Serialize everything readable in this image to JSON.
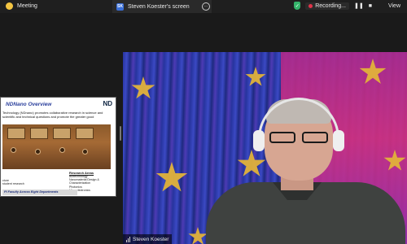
{
  "topbar": {
    "meeting_label": "Meeting",
    "share_initials": "SK",
    "share_label": "Steven Koester's screen",
    "more_symbol": "···",
    "recording_label": "Recording...",
    "pause_symbol": "❚❚",
    "stop_symbol": "■",
    "view_label": "View",
    "icons": [
      "meeting-icon",
      "shield-check-icon",
      "record-dot-icon",
      "pause-icon",
      "stop-icon",
      "view-grid-icon"
    ],
    "colors": {
      "bar": "#1f1f1f",
      "recording": "#e0344a",
      "shield": "#34b36a",
      "badge": "#3a6fd8"
    }
  },
  "thumbnail": {
    "slide_title": "NDNano Overview",
    "logo_text": "ND",
    "slide_text_1": "Technology (NDnano) promotes collaborative research in science and",
    "slide_text_2": "scientific and technical questions and promote the greater good",
    "research_title": "Research Areas",
    "research_items": [
      "Biotechnology",
      "Nanomaterial Design & Characterization",
      "Photonics",
      "Microelectronics"
    ],
    "left_items": [
      "cture",
      "student research"
    ],
    "banner": "PI Faculty Across Eight Departments"
  },
  "video": {
    "participant_name": "Steven Koester",
    "icons": [
      "mic-level-icon"
    ]
  }
}
